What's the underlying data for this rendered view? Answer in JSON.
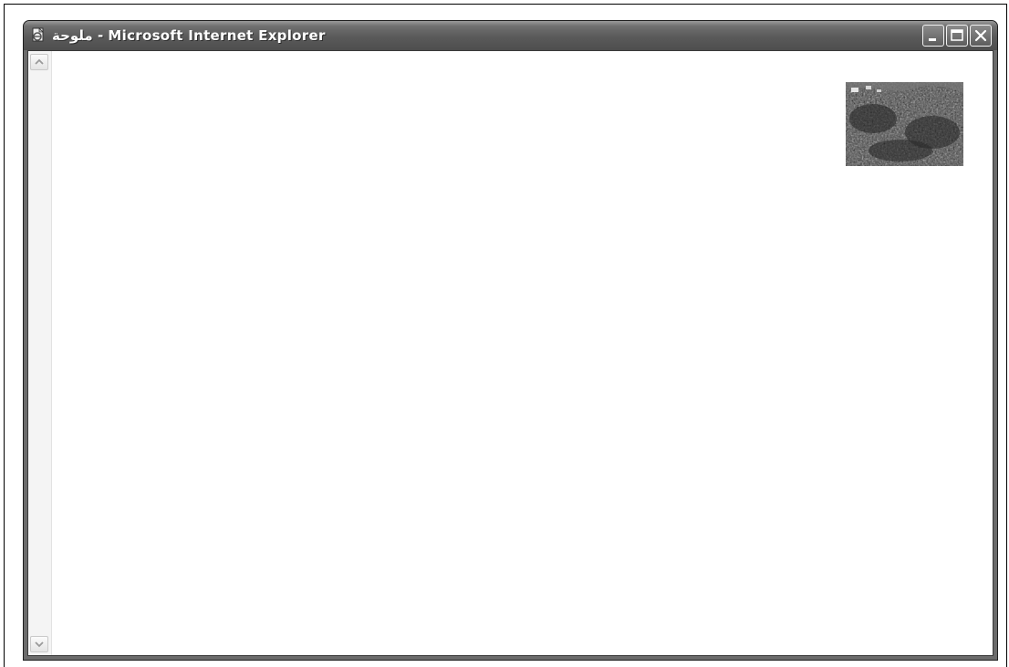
{
  "window": {
    "title": "ملوحة - Microsoft Internet Explorer",
    "app_icon": "ie-page-icon",
    "buttons": {
      "minimize_icon": "minimize-icon",
      "maximize_icon": "maximize-icon",
      "close_icon": "close-icon"
    }
  },
  "content": {
    "image_icon": "landscape-photo-thumbnail",
    "scrollbar": {
      "up_icon": "scroll-up-arrow-icon",
      "down_icon": "scroll-down-arrow-icon"
    }
  },
  "colors": {
    "titlebar": "#5a5a5a",
    "frame": "#6b6b6b",
    "client_background": "#ffffff"
  }
}
